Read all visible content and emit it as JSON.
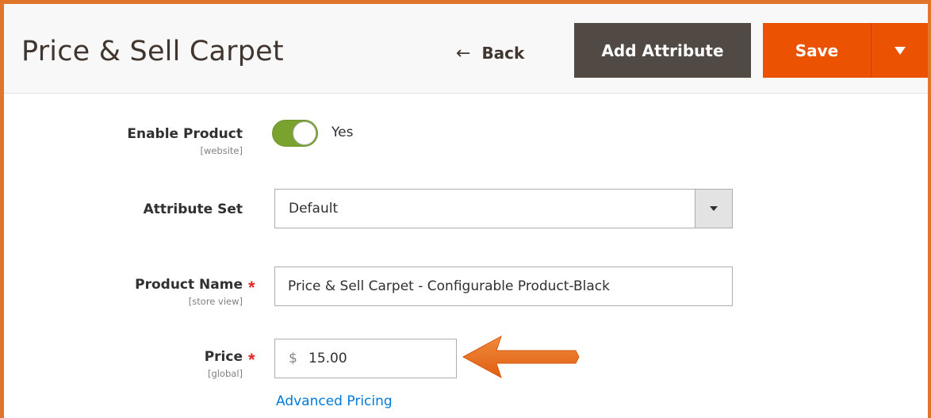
{
  "header": {
    "title": "Price & Sell Carpet",
    "back_label": "Back",
    "add_attribute_label": "Add Attribute",
    "save_label": "Save"
  },
  "form": {
    "enable_product": {
      "label": "Enable Product",
      "scope": "[website]",
      "value_label": "Yes",
      "enabled": true
    },
    "attribute_set": {
      "label": "Attribute Set",
      "selected": "Default"
    },
    "product_name": {
      "label": "Product Name",
      "scope": "[store view]",
      "required_mark": "*",
      "value": "Price & Sell Carpet - Configurable Product-Black"
    },
    "price": {
      "label": "Price",
      "scope": "[global]",
      "required_mark": "*",
      "currency_symbol": "$",
      "value": "15.00",
      "advanced_link": "Advanced Pricing"
    }
  },
  "colors": {
    "frame": "#e2752c",
    "primary_button": "#eb5202",
    "secondary_button": "#514943",
    "toggle_on": "#79a22e",
    "link": "#007bdb",
    "required": "#e22626",
    "callout_arrow": "#eb6b1f"
  },
  "icons": {
    "back": "arrow-left-icon",
    "save_menu": "caret-down-icon",
    "select": "caret-down-icon",
    "annotation": "arrow-left-callout-icon"
  }
}
